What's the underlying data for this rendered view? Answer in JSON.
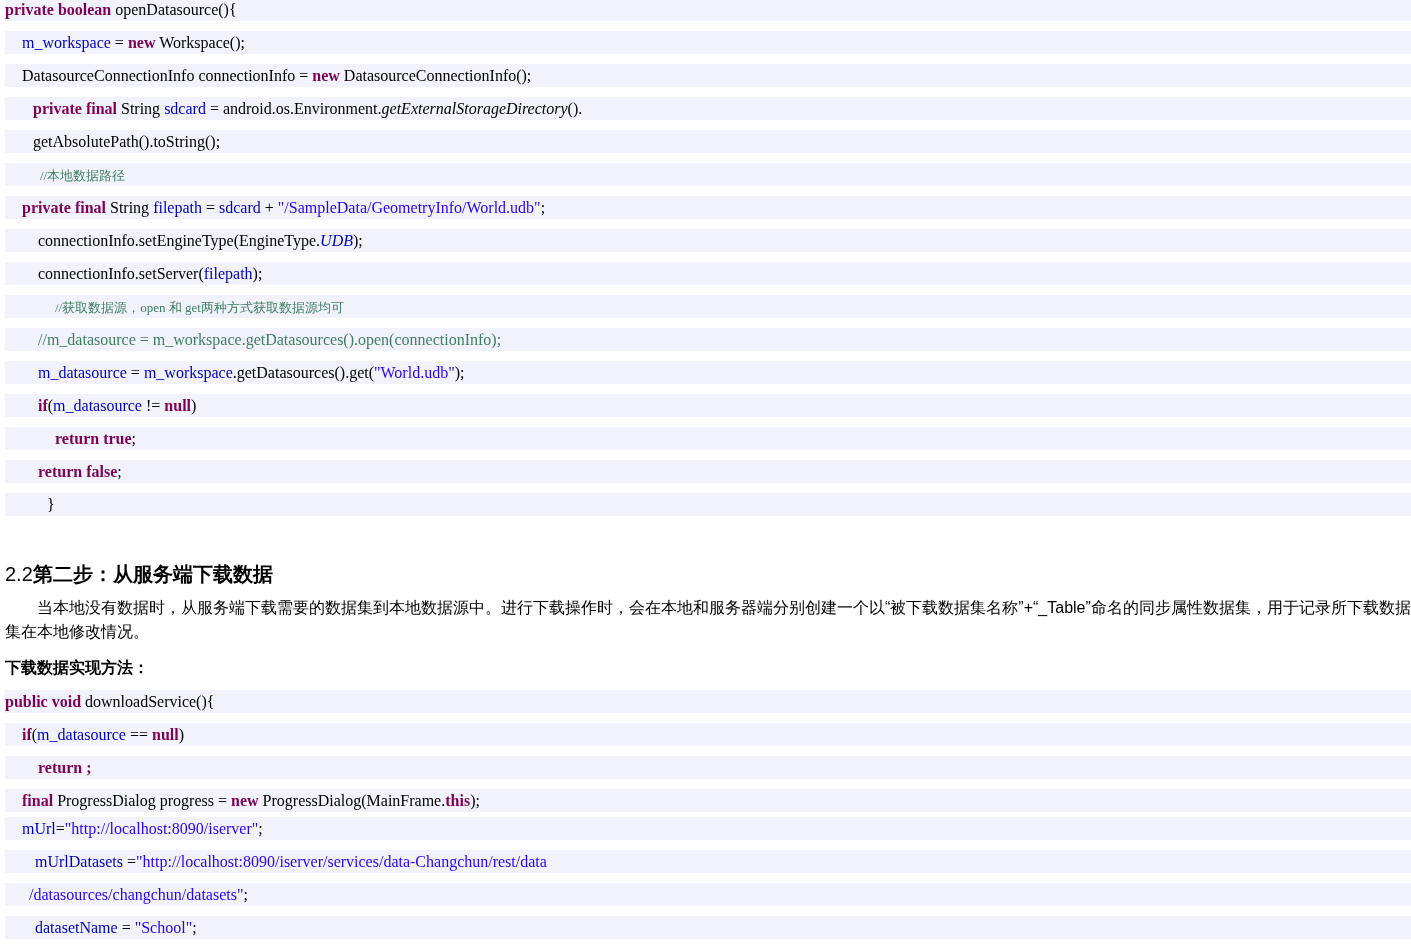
{
  "code_block_1": [
    {
      "tokens": [
        {
          "kind": "keyword",
          "text": "private boolean"
        },
        {
          "kind": "plain",
          "text": " openDatasource(){"
        }
      ]
    },
    {
      "tokens": [
        {
          "kind": "ident",
          "text": "m_workspace"
        },
        {
          "kind": "plain",
          "text": " = "
        },
        {
          "kind": "keyword",
          "text": "new"
        },
        {
          "kind": "plain",
          "text": " Workspace();"
        }
      ]
    },
    {
      "tokens": [
        {
          "kind": "plain",
          "text": "DatasourceConnectionInfo connectionInfo = "
        },
        {
          "kind": "keyword",
          "text": "new"
        },
        {
          "kind": "plain",
          "text": " DatasourceConnectionInfo();"
        }
      ]
    },
    {
      "tokens": [
        {
          "kind": "keyword",
          "text": "private final"
        },
        {
          "kind": "plain",
          "text": " String "
        },
        {
          "kind": "ident",
          "text": "sdcard"
        },
        {
          "kind": "plain",
          "text": " = android.os.Environment."
        },
        {
          "kind": "static",
          "text": "getExternalStorageDirectory"
        },
        {
          "kind": "plain",
          "text": "()."
        }
      ]
    },
    {
      "tokens": [
        {
          "kind": "plain",
          "text": "getAbsolutePath().toString();"
        }
      ]
    },
    {
      "tokens": [
        {
          "kind": "note",
          "text": "//本地数据路径"
        }
      ]
    },
    {
      "tokens": [
        {
          "kind": "keyword",
          "text": "private final"
        },
        {
          "kind": "plain",
          "text": " String "
        },
        {
          "kind": "ident",
          "text": "filepath"
        },
        {
          "kind": "plain",
          "text": " = "
        },
        {
          "kind": "ident",
          "text": "sdcard"
        },
        {
          "kind": "plain",
          "text": " + "
        },
        {
          "kind": "string",
          "text": "\"/SampleData/GeometryInfo/World.udb\""
        },
        {
          "kind": "plain",
          "text": ";"
        }
      ]
    },
    {
      "tokens": [
        {
          "kind": "plain",
          "text": "connectionInfo.setEngineType(EngineType."
        },
        {
          "kind": "constant",
          "text": "UDB"
        },
        {
          "kind": "plain",
          "text": ");"
        }
      ]
    },
    {
      "tokens": [
        {
          "kind": "plain",
          "text": "connectionInfo.setServer("
        },
        {
          "kind": "ident",
          "text": "filepath"
        },
        {
          "kind": "plain",
          "text": ");"
        }
      ]
    },
    {
      "tokens": [
        {
          "kind": "note",
          "text": "//获取数据源，open 和 get两种方式获取数据源均可"
        }
      ]
    },
    {
      "tokens": [
        {
          "kind": "comment",
          "text": "//m_datasource = m_workspace.getDatasources().open(connectionInfo);"
        }
      ]
    },
    {
      "tokens": [
        {
          "kind": "ident",
          "text": "m_datasource"
        },
        {
          "kind": "plain",
          "text": " = "
        },
        {
          "kind": "ident",
          "text": "m_workspace"
        },
        {
          "kind": "plain",
          "text": ".getDatasources().get("
        },
        {
          "kind": "string",
          "text": "\"World.udb\""
        },
        {
          "kind": "plain",
          "text": ");"
        }
      ]
    },
    {
      "tokens": [
        {
          "kind": "keyword",
          "text": "if"
        },
        {
          "kind": "plain",
          "text": "("
        },
        {
          "kind": "ident",
          "text": "m_datasource"
        },
        {
          "kind": "plain",
          "text": " != "
        },
        {
          "kind": "keyword",
          "text": "null"
        },
        {
          "kind": "plain",
          "text": ")"
        }
      ]
    },
    {
      "tokens": [
        {
          "kind": "keyword",
          "text": "return true"
        },
        {
          "kind": "plain",
          "text": ";"
        }
      ]
    },
    {
      "tokens": [
        {
          "kind": "keyword",
          "text": "return false"
        },
        {
          "kind": "plain",
          "text": ";"
        }
      ]
    },
    {
      "tokens": [
        {
          "kind": "plain",
          "text": "}"
        }
      ]
    }
  ],
  "section_heading": "2.2**第二步：从服务端下载数据**",
  "paragraph": "当本地没有数据时，从服务端下载需要的数据集到本地数据源中。进行下载操作时，会在本地和服务器端分别创建一个以“被下载数据集名称”+“_Table”命名的同步属性数据集，用于记录所下载数据集在本地修改情况。",
  "subheading": "下载数据实现方法：",
  "code_block_2": [
    {
      "tokens": [
        {
          "kind": "keyword",
          "text": "public void"
        },
        {
          "kind": "plain",
          "text": " downloadService(){"
        }
      ]
    },
    {
      "tokens": [
        {
          "kind": "keyword",
          "text": "if"
        },
        {
          "kind": "plain",
          "text": "("
        },
        {
          "kind": "ident",
          "text": "m_datasource"
        },
        {
          "kind": "plain",
          "text": " == "
        },
        {
          "kind": "keyword",
          "text": "null"
        },
        {
          "kind": "plain",
          "text": ")"
        }
      ]
    },
    {
      "tokens": [
        {
          "kind": "keyword",
          "text": "return ;"
        }
      ]
    },
    {
      "tokens": [
        {
          "kind": "keyword",
          "text": "final"
        },
        {
          "kind": "plain",
          "text": " ProgressDialog progress = "
        },
        {
          "kind": "keyword",
          "text": "new"
        },
        {
          "kind": "plain",
          "text": " ProgressDialog(MainFrame."
        },
        {
          "kind": "keyword",
          "text": "this"
        },
        {
          "kind": "plain",
          "text": ");"
        }
      ]
    },
    {
      "tokens": [
        {
          "kind": "ident",
          "text": "mUrl"
        },
        {
          "kind": "plain",
          "text": "="
        },
        {
          "kind": "string",
          "text": "\"http://localhost:8090/iserver\""
        },
        {
          "kind": "plain",
          "text": ";"
        }
      ]
    },
    {
      "tokens": [
        {
          "kind": "ident",
          "text": "mUrlDatasets"
        },
        {
          "kind": "plain",
          "text": " ="
        },
        {
          "kind": "string",
          "text": "\"http://localhost:8090/iserver/services/data-Changchun/rest/data"
        }
      ]
    },
    {
      "tokens": [
        {
          "kind": "string",
          "text": "/datasources/changchun/datasets\""
        },
        {
          "kind": "plain",
          "text": ";"
        }
      ]
    },
    {
      "tokens": [
        {
          "kind": "ident",
          "text": "datasetName"
        },
        {
          "kind": "plain",
          "text": " = "
        },
        {
          "kind": "string",
          "text": "\"School\""
        },
        {
          "kind": "plain",
          "text": ";"
        }
      ]
    }
  ]
}
